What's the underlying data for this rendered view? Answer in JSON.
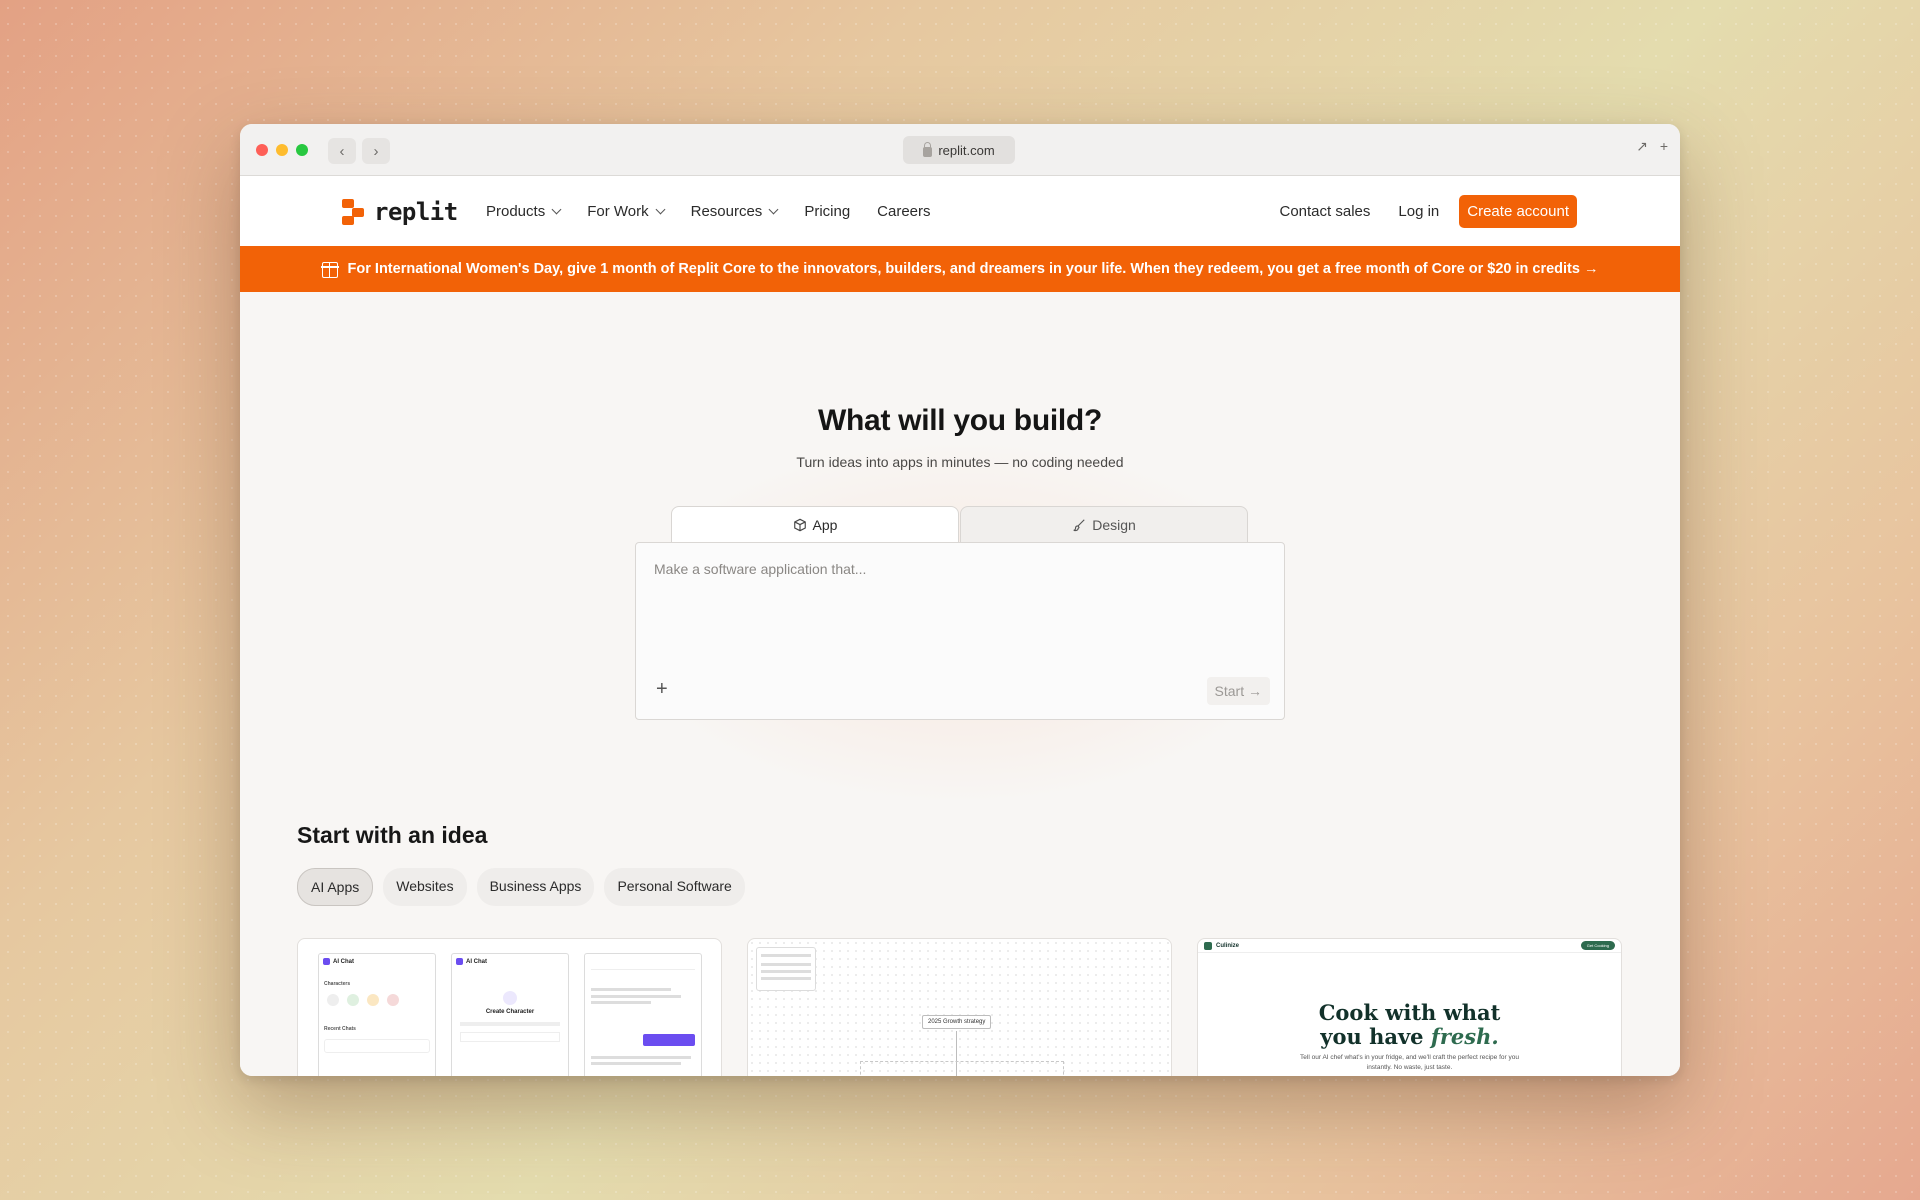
{
  "browser": {
    "url": "replit.com",
    "back_icon": "‹",
    "forward_icon": "›"
  },
  "nav": {
    "logo_text": "replit",
    "links": [
      "Products",
      "For Work",
      "Resources",
      "Pricing",
      "Careers"
    ],
    "contact_sales": "Contact sales",
    "login": "Log in",
    "create_account": "Create account"
  },
  "banner": {
    "text": "For International Women's Day, give 1 month of Replit Core to the innovators, builders, and dreamers in your life. When they redeem, you get a free month of Core or $20 in credits →"
  },
  "hero": {
    "title": "What will you build?",
    "subtitle": "Turn ideas into apps in minutes — no coding needed",
    "tab_app": "App",
    "tab_design": "Design",
    "placeholder": "Make a software application that...",
    "add_label": "+",
    "start_label": "Start"
  },
  "ideas": {
    "title": "Start with an idea",
    "chips": [
      "AI Apps",
      "Websites",
      "Business Apps",
      "Personal Software"
    ]
  },
  "cards": {
    "ai_chat": {
      "app_name": "AI Chat",
      "characters_label": "Characters",
      "recent_chats_label": "Recent Chats",
      "create_title": "Create Character"
    },
    "flow": {
      "node_label": "2025 Growth strategy"
    },
    "cook": {
      "brand": "Culinize",
      "title_line1": "Cook with what",
      "title_line2": "you have",
      "title_em": "fresh.",
      "subtitle": "Tell our AI chef what's in your fridge, and we'll craft the perfect recipe for you instantly. No waste, just taste.",
      "cta": "Get Cooking"
    }
  },
  "colors": {
    "brand_orange": "#f26207",
    "accent_purple": "#6b4df0",
    "cook_green": "#2e6b4f"
  }
}
